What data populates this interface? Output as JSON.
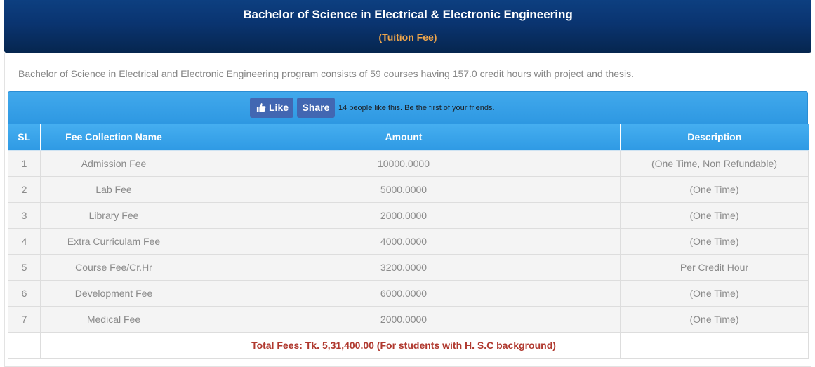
{
  "header": {
    "title": "Bachelor of Science in Electrical & Electronic Engineering",
    "subtitle": "(Tuition Fee)"
  },
  "intro": "Bachelor of Science in Electrical and Electronic Engineering program consists of 59 courses having 157.0 credit hours with project and thesis.",
  "facebook": {
    "like_label": "Like",
    "share_label": "Share",
    "social_text": "14 people like this. Be the first of your friends."
  },
  "table": {
    "headers": [
      "SL",
      "Fee Collection Name",
      "Amount",
      "Description"
    ],
    "rows": [
      {
        "sl": "1",
        "name": "Admission Fee",
        "amount": "10000.0000",
        "description": "(One Time, Non Refundable)"
      },
      {
        "sl": "2",
        "name": "Lab Fee",
        "amount": "5000.0000",
        "description": "(One Time)"
      },
      {
        "sl": "3",
        "name": "Library Fee",
        "amount": "2000.0000",
        "description": "(One Time)"
      },
      {
        "sl": "4",
        "name": "Extra Curriculam Fee",
        "amount": "4000.0000",
        "description": "(One Time)"
      },
      {
        "sl": "5",
        "name": "Course Fee/Cr.Hr",
        "amount": "3200.0000",
        "description": "Per Credit Hour"
      },
      {
        "sl": "6",
        "name": "Development Fee",
        "amount": "6000.0000",
        "description": "(One Time)"
      },
      {
        "sl": "7",
        "name": "Medical Fee",
        "amount": "2000.0000",
        "description": "(One Time)"
      }
    ],
    "total": "Total Fees: Tk. 5,31,400.00 (For students with H. S.C background)"
  },
  "colors": {
    "header_bg": "#0a3470",
    "subtitle": "#f0a64a",
    "table_header": "#3aa3ea",
    "facebook_blue": "#4267b2",
    "total_text": "#b0392f"
  }
}
